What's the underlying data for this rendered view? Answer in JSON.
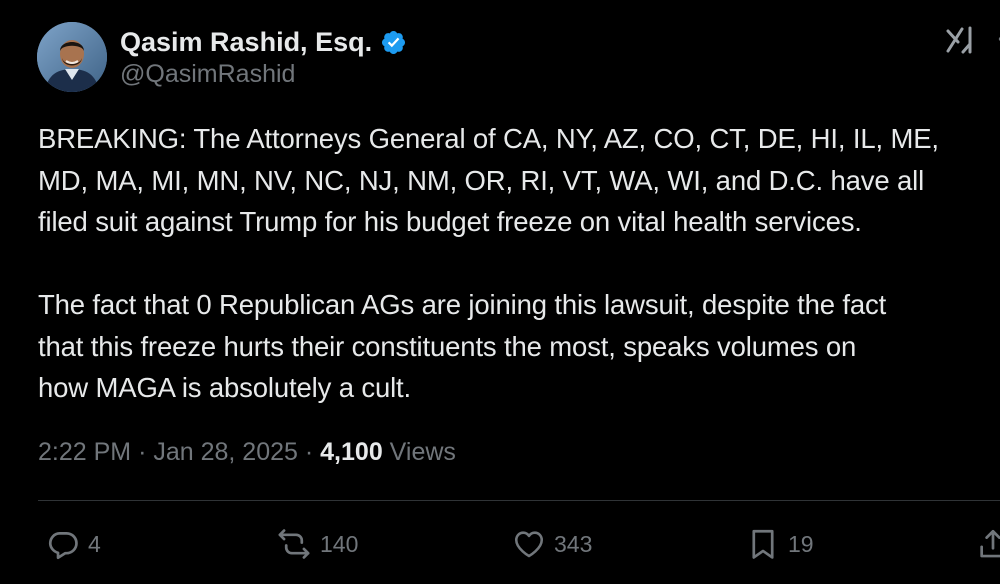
{
  "author": {
    "display_name": "Qasim Rashid, Esq.",
    "handle": "@QasimRashid",
    "verified": true,
    "verified_color": "#1d9bf0"
  },
  "tweet": {
    "paragraphs": [
      "BREAKING: The Attorneys General of CA, NY, AZ, CO, CT, DE, HI, IL, ME,\nMD, MA, MI, MN, NV, NC, NJ, NM, OR, RI, VT, WA, WI, and D.C. have all\nfiled suit against Trump for his budget freeze on vital health services.",
      "The fact that 0 Republican AGs are joining this lawsuit, despite the fact\nthat this freeze hurts their constituents the most, speaks volumes on\nhow MAGA is absolutely a cult."
    ],
    "time": "2:22 PM",
    "date": "Jan 28, 2025",
    "separator": "·",
    "views_count": "4,100",
    "views_label": "Views"
  },
  "actions": {
    "replies": "4",
    "reposts": "140",
    "likes": "343",
    "bookmarks": "19"
  },
  "icons": {
    "top_right": [
      "grok-icon",
      "more-icon"
    ],
    "actions": [
      "reply-icon",
      "repost-icon",
      "like-icon",
      "bookmark-icon",
      "share-icon"
    ]
  },
  "colors": {
    "background": "#000000",
    "text": "#e7e9ea",
    "secondary_text": "#71767b",
    "divider": "#2f3336",
    "accent": "#1d9bf0"
  }
}
